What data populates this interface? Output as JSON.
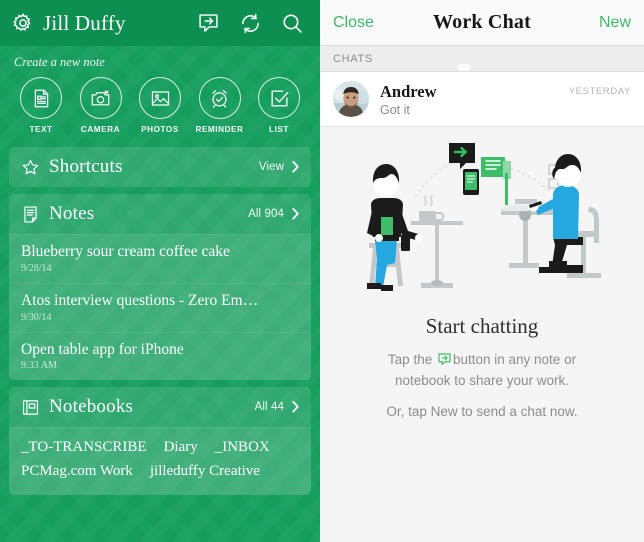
{
  "left_panel": {
    "topbar": {
      "gear_icon": "gear-icon",
      "user_name": "Jill Duffy",
      "icons": [
        "share-chat-icon",
        "sync-icon",
        "search-icon"
      ]
    },
    "create": {
      "label": "Create a new note",
      "items": [
        {
          "icon": "text-note-icon",
          "caption": "TEXT"
        },
        {
          "icon": "camera-icon",
          "caption": "CAMERA"
        },
        {
          "icon": "photos-icon",
          "caption": "PHOTOS"
        },
        {
          "icon": "reminder-alarm-icon",
          "caption": "REMINDER"
        },
        {
          "icon": "list-checkbox-icon",
          "caption": "LIST"
        }
      ]
    },
    "shortcuts": {
      "icon": "star-icon",
      "title": "Shortcuts",
      "action": "View"
    },
    "notes": {
      "icon": "note-page-icon",
      "title": "Notes",
      "action": "All 904",
      "items": [
        {
          "title": "Blueberry sour cream coffee cake",
          "date": "9/28/14"
        },
        {
          "title": "Atos interview questions - Zero Em…",
          "date": "9/30/14"
        },
        {
          "title": "Open table app for iPhone",
          "date": "9:33 AM"
        }
      ]
    },
    "notebooks": {
      "icon": "notebook-icon",
      "title": "Notebooks",
      "action": "All 44",
      "rows": [
        [
          "_TO-TRANSCRIBE",
          "Diary",
          "_INBOX"
        ],
        [
          "PCMag.com Work",
          "jilleduffy Creative"
        ]
      ]
    }
  },
  "right_panel": {
    "nav": {
      "close_label": "Close",
      "title": "Work Chat",
      "new_label": "New"
    },
    "section_header": "CHATS",
    "chats": [
      {
        "avatar": "user-photo-avatar",
        "name": "Andrew",
        "snippet": "Got it",
        "time": "YESTERDAY"
      }
    ],
    "empty_state": {
      "illustration": "two-people-sharing-notes-illustration",
      "title": "Start chatting",
      "line_before_icon": "Tap the",
      "inline_icon": "share-chat-icon",
      "line_after_icon": "button in any note or",
      "line2": "notebook to share your work.",
      "line3": "Or, tap New to send a chat now."
    }
  },
  "colors": {
    "green_bg": "#17a05f",
    "green_topbar": "#0d8f52",
    "accent_green": "#3db86a",
    "brand_green": "#2dbe60",
    "panel_bg": "#f5f5f5",
    "text_muted": "#8d8d8d"
  }
}
